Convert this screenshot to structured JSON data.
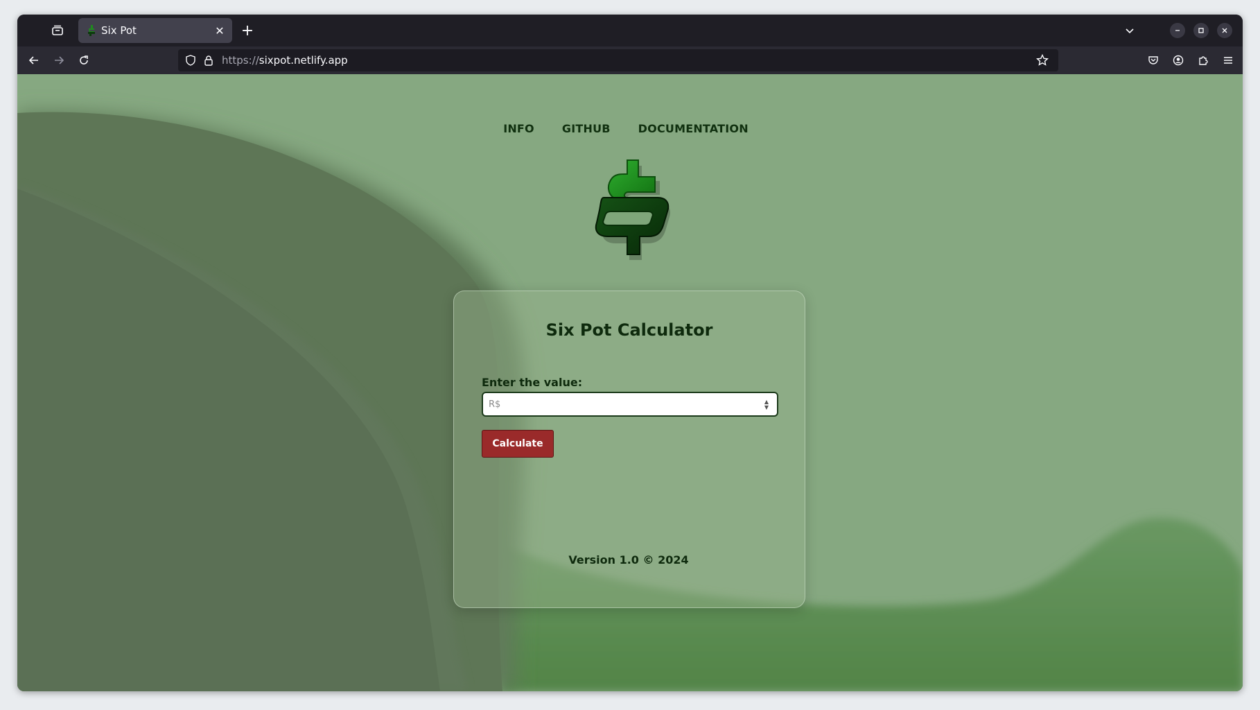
{
  "browser": {
    "tab": {
      "title": "Six Pot"
    },
    "url": {
      "scheme": "https://",
      "host": "sixpot.netlify.app"
    }
  },
  "page": {
    "nav": {
      "info": "INFO",
      "github": "GITHUB",
      "documentation": "DOCUMENTATION"
    },
    "card": {
      "title": "Six Pot Calculator",
      "input_label": "Enter the value:",
      "input_placeholder": "R$",
      "input_value": "",
      "button_label": "Calculate"
    },
    "footer": "Version 1.0 © 2024"
  },
  "colors": {
    "page_background": "#86a881",
    "accent_button": "#9a2a2a",
    "logo_green": "#1f8a1f",
    "logo_dark_green": "#0c3b0c"
  },
  "icons": {
    "tab_list": "tab-list-icon",
    "favicon": "dollar-favicon-icon",
    "close_tab": "close-icon",
    "new_tab": "plus-icon",
    "tabs_dropdown": "chevron-down-icon",
    "back": "back-arrow-icon",
    "forward": "forward-arrow-icon",
    "reload": "reload-icon",
    "shield": "shield-icon",
    "lock": "lock-icon",
    "bookmark": "star-icon",
    "pocket": "pocket-icon",
    "account": "account-icon",
    "extensions": "puzzle-icon",
    "menu": "hamburger-menu-icon",
    "logo": "dollar-logo-icon"
  }
}
